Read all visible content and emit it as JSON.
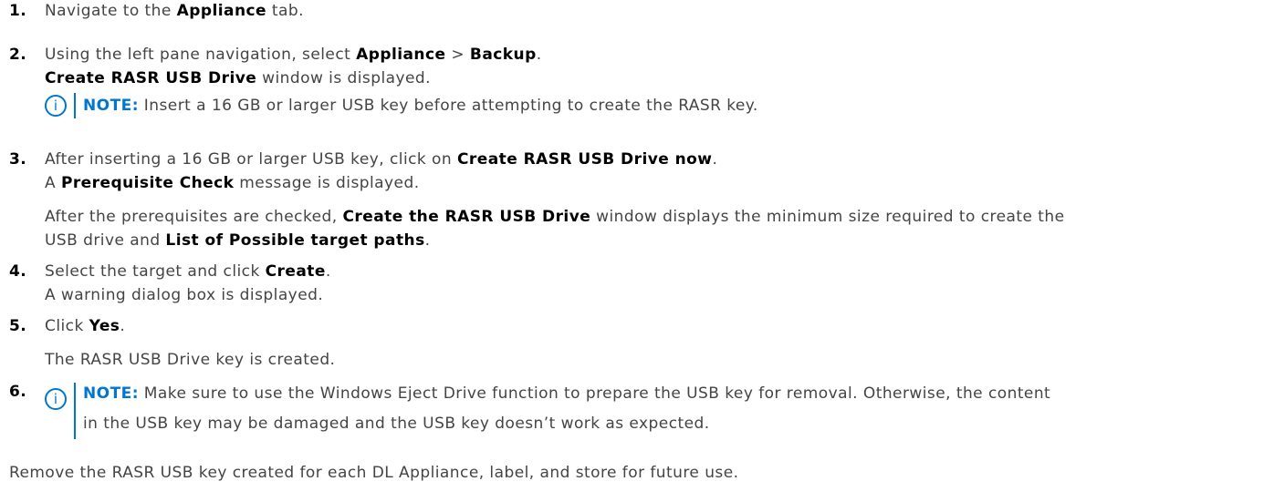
{
  "steps": [
    {
      "number": "1.",
      "lines": [
        [
          "Navigate to the ",
          {
            "b": "Appliance"
          },
          " tab."
        ]
      ]
    },
    {
      "number": "2.",
      "lines": [
        [
          "Using the left pane navigation, select ",
          {
            "b": "Appliance"
          },
          " > ",
          {
            "b": "Backup"
          },
          "."
        ],
        [
          {
            "b": "Create RASR USB Drive"
          },
          " window is displayed."
        ]
      ],
      "note": {
        "label": "NOTE:",
        "text": " Insert a 16 GB or larger USB key before attempting to create the RASR key."
      }
    },
    {
      "number": "3.",
      "lines": [
        [
          "After inserting a 16 GB or larger USB key, click on ",
          {
            "b": "Create RASR USB Drive now"
          },
          "."
        ],
        [
          "A ",
          {
            "b": "Prerequisite Check"
          },
          " message is displayed."
        ],
        [
          "After the prerequisites are checked, ",
          {
            "b": "Create the RASR USB Drive"
          },
          " window displays the minimum size required to create the"
        ],
        [
          "USB drive and ",
          {
            "b": "List of Possible target paths"
          },
          "."
        ]
      ]
    },
    {
      "number": "4.",
      "lines": [
        [
          "Select the target and click ",
          {
            "b": "Create"
          },
          "."
        ],
        [
          "A warning dialog box is displayed."
        ]
      ]
    },
    {
      "number": "5.",
      "lines": [
        [
          "Click ",
          {
            "b": "Yes"
          },
          "."
        ],
        [
          "The RASR USB Drive key is created."
        ]
      ]
    },
    {
      "number": "6.",
      "lines": [],
      "note": {
        "label": "NOTE:",
        "lines": [
          " Make sure to use the Windows Eject Drive function to prepare the USB key for removal. Otherwise, the content",
          "in the USB key may be damaged and the USB key doesn’t work as expected."
        ]
      }
    }
  ],
  "closing_text": "Remove the RASR USB key created for each DL Appliance, label, and store for future use.",
  "note_icon": "info-icon",
  "colors": {
    "accent": "#0076ce",
    "text": "#444444",
    "bold": "#000000"
  }
}
